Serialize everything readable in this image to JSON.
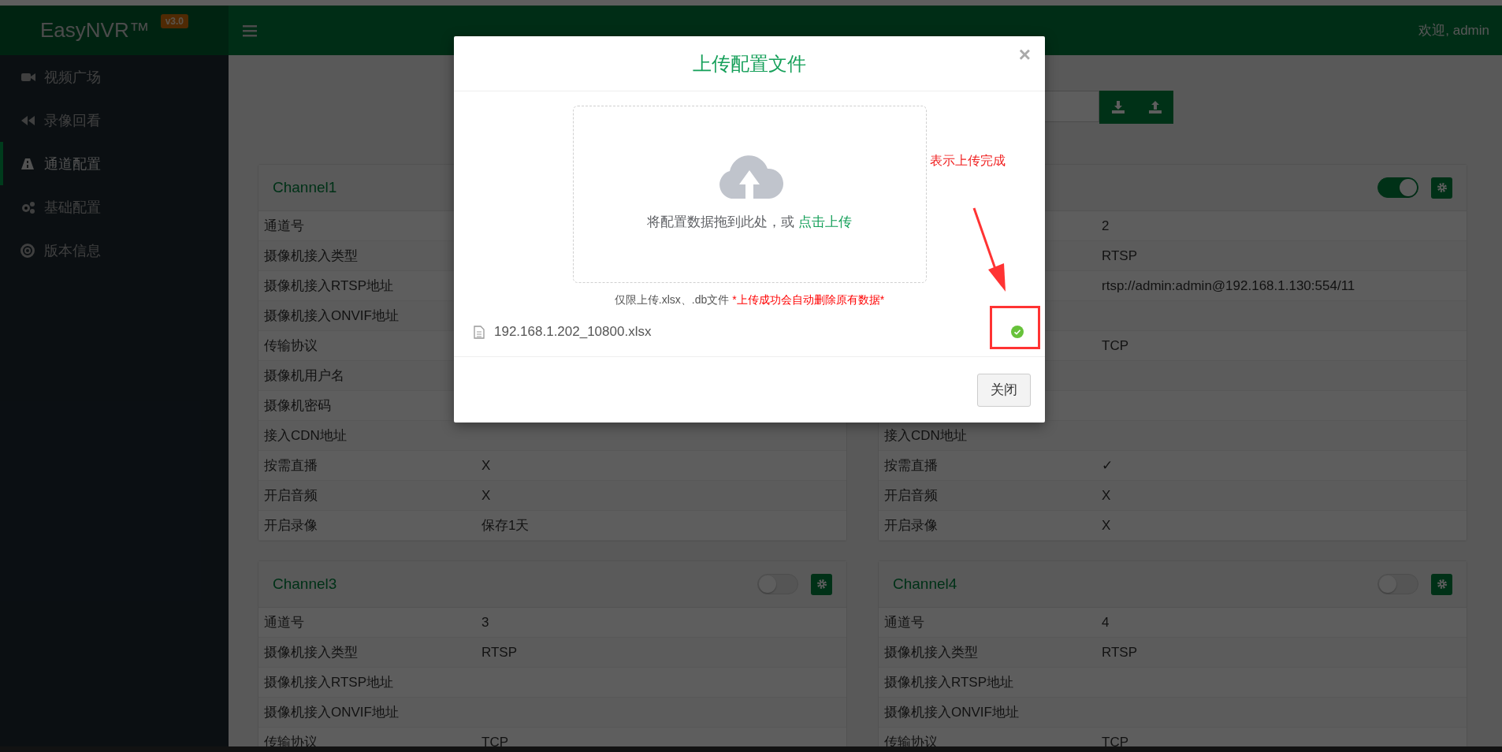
{
  "header": {
    "logo": "EasyNVR™",
    "version": "v3.0",
    "welcome": "欢迎, admin"
  },
  "sidebar": {
    "items": [
      {
        "label": "视频广场",
        "selected": false
      },
      {
        "label": "录像回看",
        "selected": false
      },
      {
        "label": "通道配置",
        "selected": true
      },
      {
        "label": "基础配置",
        "selected": false
      },
      {
        "label": "版本信息",
        "selected": false
      }
    ]
  },
  "cards": [
    {
      "title": "Channel1",
      "rows": [
        {
          "label": "通道号"
        },
        {
          "label": "摄像机接入类型"
        },
        {
          "label": "摄像机接入RTSP地址"
        },
        {
          "label": "摄像机接入ONVIF地址"
        },
        {
          "label": "传输协议"
        },
        {
          "label": "摄像机用户名"
        },
        {
          "label": "摄像机密码"
        },
        {
          "label": "接入CDN地址"
        },
        {
          "label": "按需直播",
          "value": "X"
        },
        {
          "label": "开启音频",
          "value": "X"
        },
        {
          "label": "开启录像",
          "value": "保存1天"
        }
      ]
    },
    {
      "on": true,
      "rows": [
        {
          "value": "2"
        },
        {
          "value": "RTSP"
        },
        {
          "value": "rtsp://admin:admin@192.168.1.130:554/11"
        },
        {},
        {
          "value": "TCP"
        },
        {},
        {},
        {
          "label": "接入CDN地址"
        },
        {
          "label": "按需直播",
          "value": "✓"
        },
        {
          "label": "开启音频",
          "value": "X"
        },
        {
          "label": "开启录像",
          "value": "X"
        }
      ]
    },
    {
      "title": "Channel3",
      "on": false,
      "rows": [
        {
          "label": "通道号",
          "value": "3"
        },
        {
          "label": "摄像机接入类型",
          "value": "RTSP"
        },
        {
          "label": "摄像机接入RTSP地址"
        },
        {
          "label": "摄像机接入ONVIF地址"
        },
        {
          "label": "传输协议",
          "value": "TCP"
        }
      ]
    },
    {
      "title": "Channel4",
      "on": false,
      "rows": [
        {
          "label": "通道号",
          "value": "4"
        },
        {
          "label": "摄像机接入类型",
          "value": "RTSP"
        },
        {
          "label": "摄像机接入RTSP地址"
        },
        {
          "label": "摄像机接入ONVIF地址"
        },
        {
          "label": "传输协议",
          "value": "TCP"
        }
      ]
    }
  ],
  "modal": {
    "title": "上传配置文件",
    "close": "×",
    "drop_text": "将配置数据拖到此处，或 ",
    "drop_link": "点击上传",
    "tip": "仅限上传.xlsx、.db文件 ",
    "warning": "*上传成功会自动删除原有数据*",
    "file": {
      "name": "192.168.1.202_10800.xlsx",
      "done": true
    },
    "button": "关闭"
  },
  "annotation": {
    "text": "表示上传完成"
  }
}
